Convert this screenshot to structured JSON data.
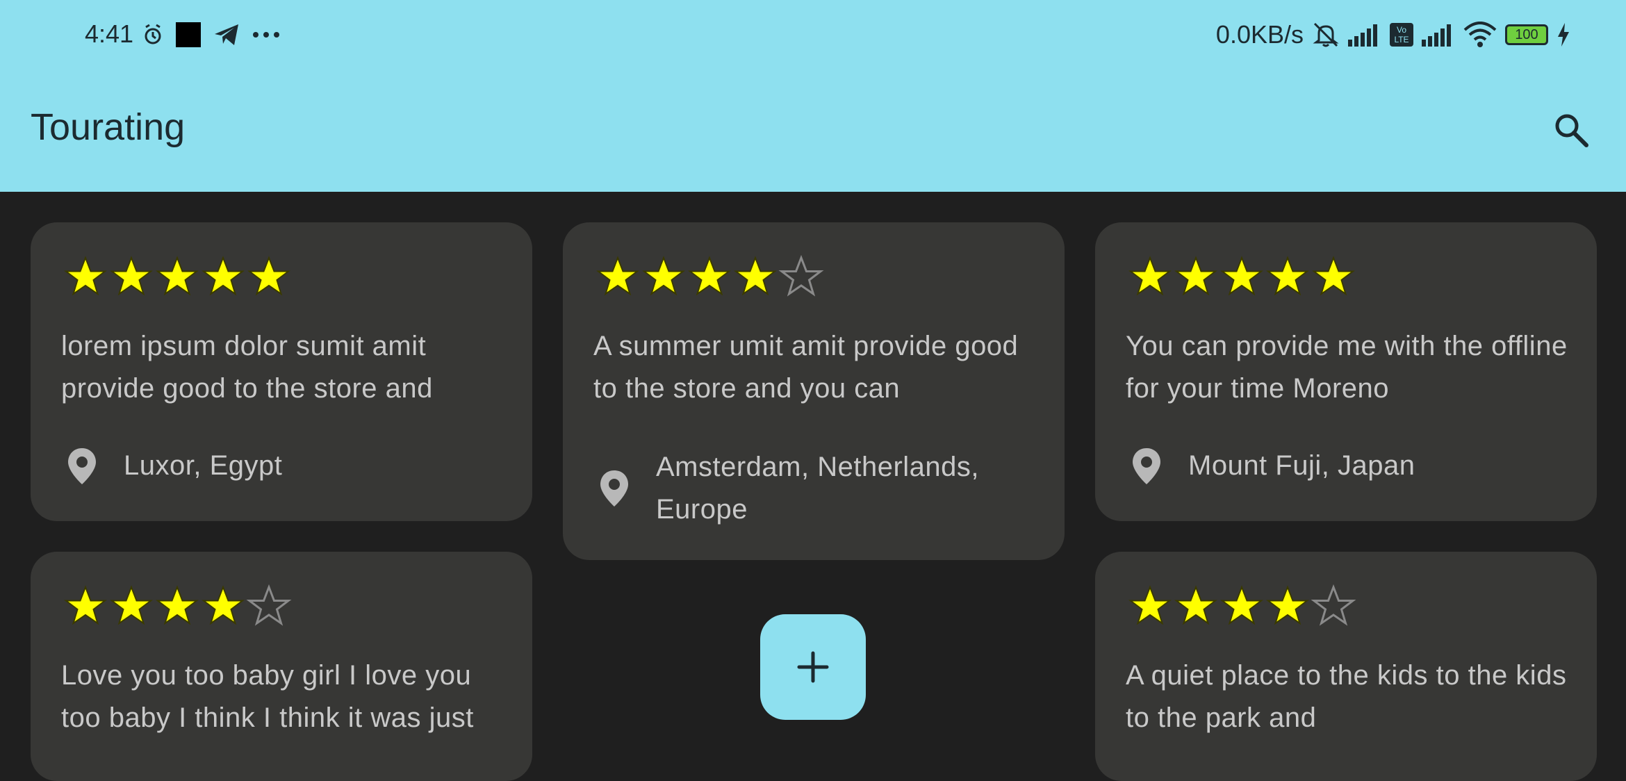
{
  "status_bar": {
    "time": "4:41",
    "net_speed": "0.0KB/s",
    "battery": "100",
    "volte": "Vo\nLTE"
  },
  "app_bar": {
    "title": "Tourating",
    "search_icon": "search-icon"
  },
  "colors": {
    "accent": "#8ee0ef",
    "background": "#1f1f1f",
    "card": "#373735",
    "star_filled": "#ffff00",
    "star_empty": "#8a8a8a",
    "text": "#c9c9c9"
  },
  "cards": [
    {
      "rating": 5,
      "text": "lorem ipsum dolor sumit amit provide good to the store and",
      "location": "Luxor, Egypt"
    },
    {
      "rating": 4,
      "text": "A summer umit amit provide good to the store and you can",
      "location": "Amsterdam, Netherlands, Europe"
    },
    {
      "rating": 5,
      "text": "You can provide me with the offline for your time Moreno",
      "location": "Mount Fuji, Japan"
    },
    {
      "rating": 4,
      "text": "Love you too baby girl I love you too baby I think I think it was just",
      "location": ""
    },
    {
      "rating": 4,
      "text": "A quiet place to the kids to the kids to the park and",
      "location": ""
    }
  ],
  "fab": {
    "icon": "plus-icon"
  }
}
